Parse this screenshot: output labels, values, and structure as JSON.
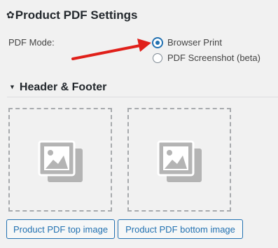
{
  "settings": {
    "title": "Product PDF Settings",
    "title_icon": "gear-icon",
    "pdf_mode_label": "PDF Mode:",
    "options": [
      {
        "label": "Browser Print",
        "selected": true
      },
      {
        "label": "PDF Screenshot (beta)",
        "selected": false
      }
    ]
  },
  "header_footer": {
    "title": "Header & Footer",
    "top_button_label": "Product PDF top image",
    "bottom_button_label": "Product PDF bottom image"
  },
  "colors": {
    "accent": "#2271b1",
    "annotation_arrow": "#e0201a",
    "placeholder_icon": "#b4b4b4"
  }
}
